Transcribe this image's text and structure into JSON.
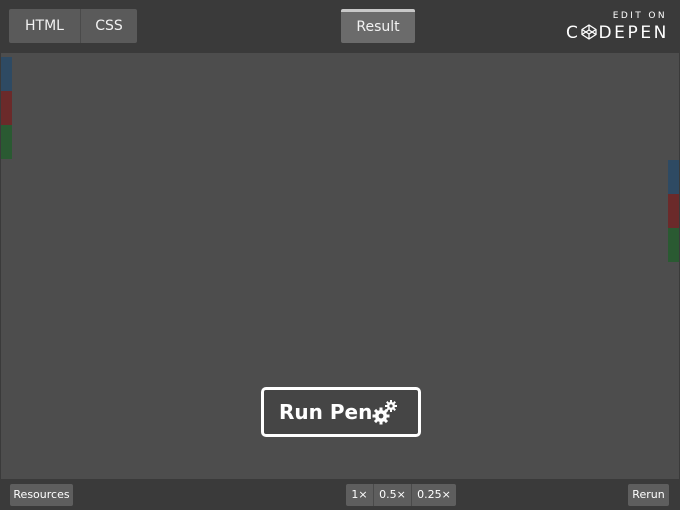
{
  "tabs": {
    "html": "HTML",
    "css": "CSS",
    "result": "Result"
  },
  "branding": {
    "edit_on": "EDIT ON",
    "name_start": "C",
    "name_end": "DEPEN",
    "logo_icon": "codepen-box-icon"
  },
  "run_button": {
    "label": "Run Pen",
    "icon": "gears-icon"
  },
  "footer": {
    "resources": "Resources",
    "zoom_options": [
      "1×",
      "0.5×",
      "0.25×"
    ],
    "rerun": "Rerun"
  },
  "colors": {
    "background": "#4d4d4d",
    "bars": "#3a3a3a",
    "strip_blue": "#2e4a63",
    "strip_red": "#6b2a2a",
    "strip_green": "#2a5a32"
  }
}
